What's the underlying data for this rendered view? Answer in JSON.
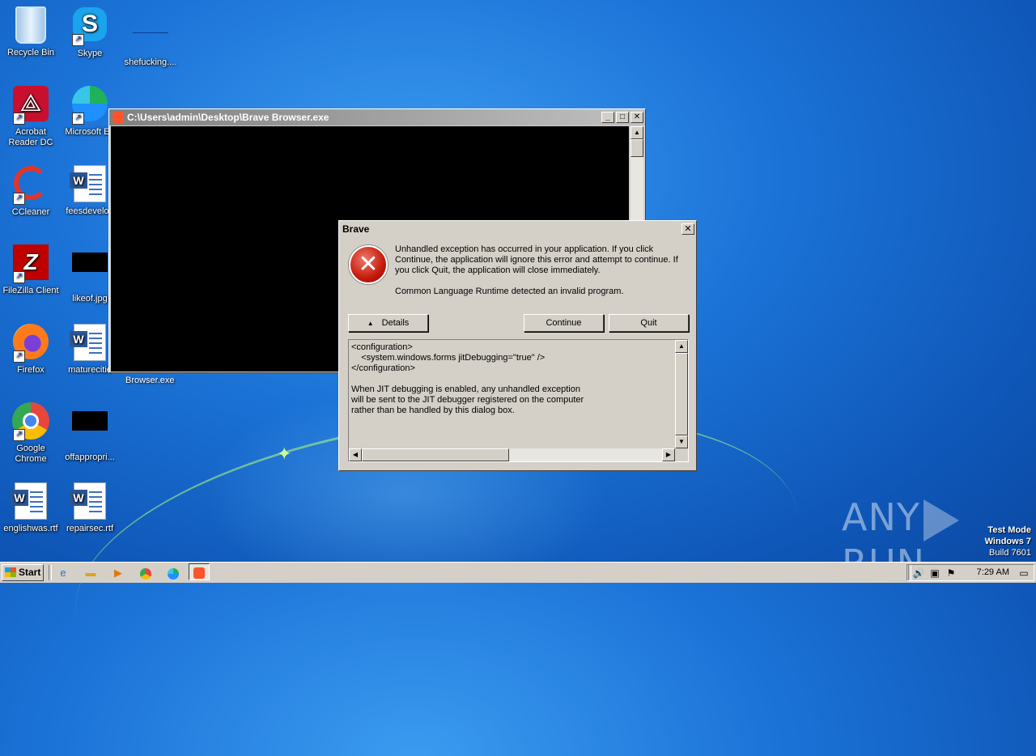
{
  "desktop": {
    "icons": [
      {
        "label": "Recycle Bin"
      },
      {
        "label": "Skype"
      },
      {
        "label": "shefucking...."
      },
      {
        "label": "Acrobat Reader DC"
      },
      {
        "label": "Microsoft Ed"
      },
      {
        "label": "CCleaner"
      },
      {
        "label": "feesdevelop"
      },
      {
        "label": "FileZilla Client"
      },
      {
        "label": "likeof.jpg"
      },
      {
        "label": "Firefox"
      },
      {
        "label": "maturecitie"
      },
      {
        "label": "Google Chrome"
      },
      {
        "label": "offappropri..."
      },
      {
        "label": "englishwas.rtf"
      },
      {
        "label": "repairsec.rtf"
      }
    ],
    "behind_label": "Browser.exe"
  },
  "console": {
    "title": "C:\\Users\\admin\\Desktop\\Brave Browser.exe",
    "minimize": "_",
    "maximize": "□",
    "close": "✕"
  },
  "dialog": {
    "title": "Brave",
    "close": "✕",
    "message1": "Unhandled exception has occurred in your application. If you click Continue, the application will ignore this error and attempt to continue. If you click Quit, the application will close immediately.",
    "message2": "Common Language Runtime detected an invalid program.",
    "details_label": "Details",
    "continue_label": "Continue",
    "quit_label": "Quit",
    "details_text": "<configuration>\n    <system.windows.forms jitDebugging=\"true\" />\n</configuration>\n\nWhen JIT debugging is enabled, any unhandled exception\nwill be sent to the JIT debugger registered on the computer\nrather than be handled by this dialog box."
  },
  "watermark": {
    "left": "ANY",
    "right": "RUN"
  },
  "system_info": {
    "line1": "Test Mode",
    "line2": "Windows 7",
    "line3": "Build 7601"
  },
  "taskbar": {
    "start_label": "Start",
    "clock": "7:29 AM"
  }
}
